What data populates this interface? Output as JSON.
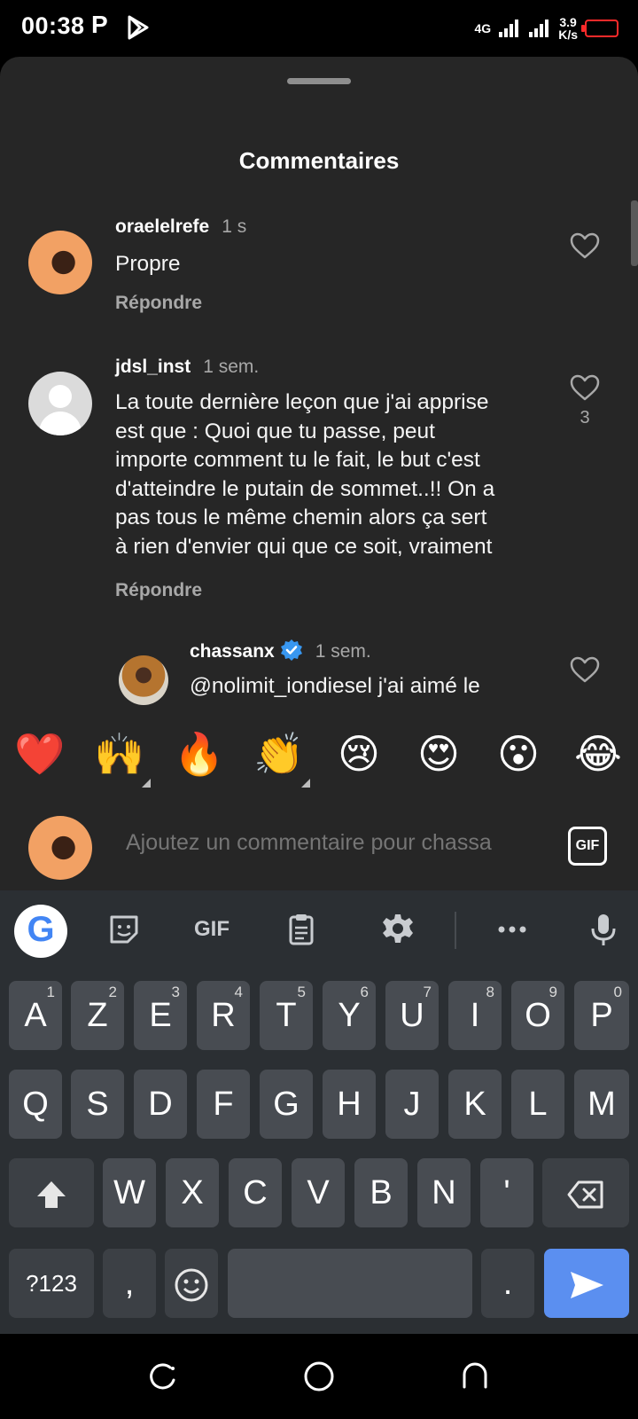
{
  "status": {
    "time": "00:38",
    "p_icon": "P",
    "network": "4G",
    "speed_value": "3.9",
    "speed_unit": "K/s"
  },
  "sheet": {
    "title": "Commentaires"
  },
  "comments": [
    {
      "username": "oraelelrefe",
      "time": "1 s",
      "text": "Propre",
      "reply": "Répondre",
      "likes": ""
    },
    {
      "username": "jdsl_inst",
      "time": "1 sem.",
      "text_lines": [
        "La toute dernière leçon que j'ai apprise",
        "est que : Quoi que tu passe, peut",
        "importe comment tu le fait, le but c'est",
        "d'atteindre le putain de sommet..!! On a",
        "pas tous le même chemin alors ça sert",
        "à rien d'envier qui que ce soit, vraiment"
      ],
      "reply": "Répondre",
      "likes": "3"
    },
    {
      "username": "chassanx",
      "time": "1 sem.",
      "text": "@nolimit_iondiesel j'ai aimé le",
      "verified": true
    }
  ],
  "emojis": [
    "❤️",
    "🙌",
    "🔥",
    "👏",
    "😢",
    "😍",
    "😮",
    "😂"
  ],
  "input": {
    "placeholder": "Ajoutez un commentaire pour chassa",
    "gif_label": "GIF"
  },
  "keyboard": {
    "google": "G",
    "gif_tool": "GIF",
    "row1": [
      {
        "k": "A",
        "h": "1"
      },
      {
        "k": "Z",
        "h": "2"
      },
      {
        "k": "E",
        "h": "3"
      },
      {
        "k": "R",
        "h": "4"
      },
      {
        "k": "T",
        "h": "5"
      },
      {
        "k": "Y",
        "h": "6"
      },
      {
        "k": "U",
        "h": "7"
      },
      {
        "k": "I",
        "h": "8"
      },
      {
        "k": "O",
        "h": "9"
      },
      {
        "k": "P",
        "h": "0"
      }
    ],
    "row2": [
      "Q",
      "S",
      "D",
      "F",
      "G",
      "H",
      "J",
      "K",
      "L",
      "M"
    ],
    "row3": [
      "W",
      "X",
      "C",
      "V",
      "B",
      "N",
      "'"
    ],
    "symbols": "?123",
    "comma": ",",
    "period": "."
  },
  "colors": {
    "sheet_bg": "#262626",
    "keyboard_bg": "#2b2f33",
    "key_bg": "#484c52",
    "enter_key": "#5b8ff0",
    "verified": "#3897f0",
    "battery": "#ff2a2a"
  }
}
